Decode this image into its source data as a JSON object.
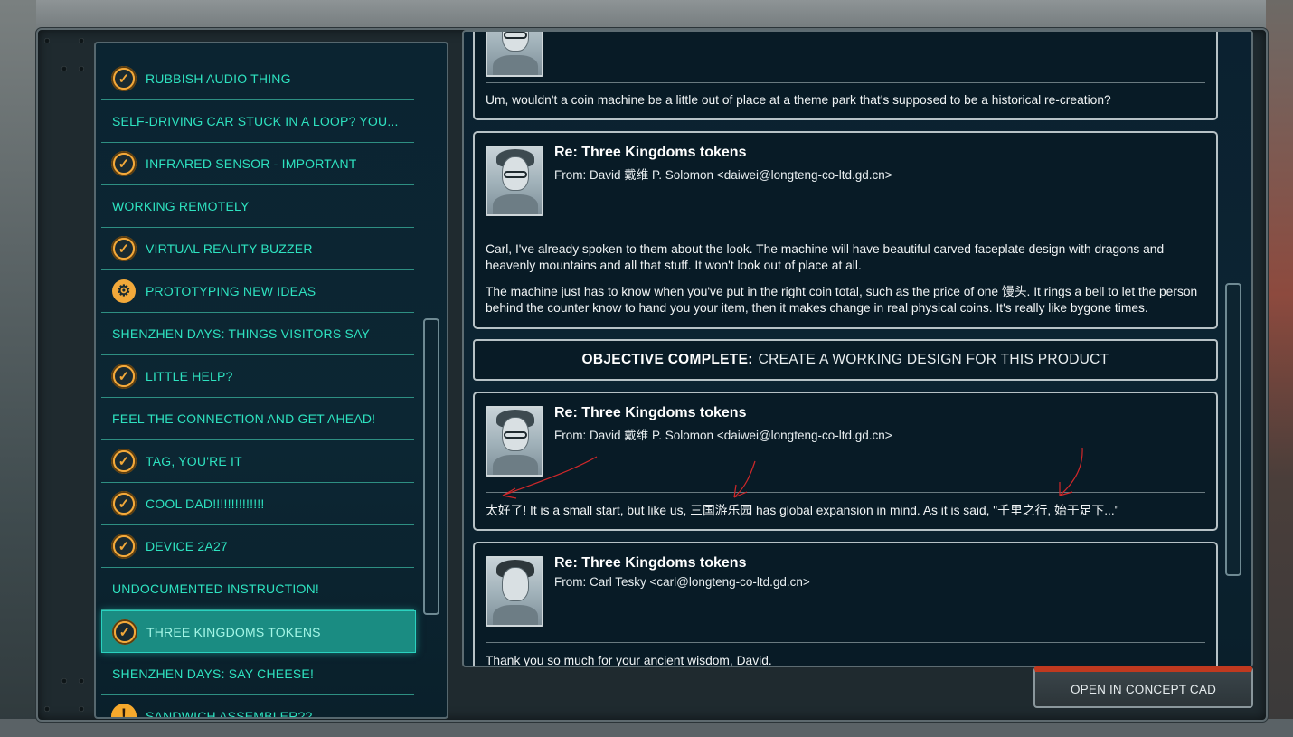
{
  "colors": {
    "accent_teal": "#2ee3c0",
    "check_orange": "#f3a93a",
    "selected_bg": "#1a8c82",
    "cad_red": "#c0391f",
    "annotation_red": "#d0282a"
  },
  "sidebar": {
    "items": [
      {
        "label": "RUBBISH AUDIO THING",
        "icon": "check-icon"
      },
      {
        "label": "SELF-DRIVING CAR STUCK IN A LOOP? YOU...",
        "icon": ""
      },
      {
        "label": "INFRARED SENSOR - IMPORTANT",
        "icon": "check-icon"
      },
      {
        "label": "WORKING REMOTELY",
        "icon": ""
      },
      {
        "label": "VIRTUAL REALITY BUZZER",
        "icon": "check-icon"
      },
      {
        "label": "PROTOTYPING NEW IDEAS",
        "icon": "gear-icon"
      },
      {
        "label": "SHENZHEN DAYS: THINGS VISITORS SAY",
        "icon": ""
      },
      {
        "label": "LITTLE HELP?",
        "icon": "check-icon"
      },
      {
        "label": "FEEL THE CONNECTION AND GET AHEAD!",
        "icon": ""
      },
      {
        "label": "TAG, YOU'RE IT",
        "icon": "check-icon"
      },
      {
        "label": "COOL DAD!!!!!!!!!!!!!!",
        "icon": "check-icon"
      },
      {
        "label": "DEVICE 2A27",
        "icon": "check-icon"
      },
      {
        "label": "UNDOCUMENTED INSTRUCTION!",
        "icon": ""
      },
      {
        "label": "THREE KINGDOMS TOKENS",
        "icon": "check-icon",
        "selected": true
      },
      {
        "label": "SHENZHEN DAYS: SAY CHEESE!",
        "icon": ""
      },
      {
        "label": "SANDWICH ASSEMBLER??",
        "icon": "warning-icon"
      }
    ]
  },
  "messages": [
    {
      "body": [
        "Um, wouldn't a coin machine be a little out of place at a theme park that's supposed to be a historical re-creation?"
      ]
    },
    {
      "subject": "Re: Three Kingdoms tokens",
      "from": "From: David 戴维 P. Solomon <daiwei@longteng-co-ltd.gd.cn>",
      "body": [
        "Carl, I've already spoken to them about the look. The machine will have beautiful carved faceplate design with dragons and heavenly mountains and all that stuff. It won't look out of place at all.",
        "The machine just has to know when you've put in the right coin total, such as the price of one 馒头. It rings a bell to let the person behind the counter know to hand you your item, then it makes change in real physical coins. It's really like bygone times."
      ]
    },
    {
      "subject": "Re: Three Kingdoms tokens",
      "from": "From: David 戴维 P. Solomon <daiwei@longteng-co-ltd.gd.cn>",
      "body": [
        "太好了! It is a small start, but like us, 三国游乐园 has global expansion in mind. As it is said, \"千里之行, 始于足下...\""
      ]
    },
    {
      "subject": "Re: Three Kingdoms tokens",
      "from": "From: Carl Tesky <carl@longteng-co-ltd.gd.cn>",
      "body": [
        "Thank you so much for your ancient wisdom, David."
      ]
    }
  ],
  "objective": {
    "strong": "OBJECTIVE COMPLETE:",
    "text": "CREATE A WORKING DESIGN FOR THIS PRODUCT"
  },
  "actions": {
    "open_cad_label": "OPEN IN CONCEPT CAD"
  }
}
